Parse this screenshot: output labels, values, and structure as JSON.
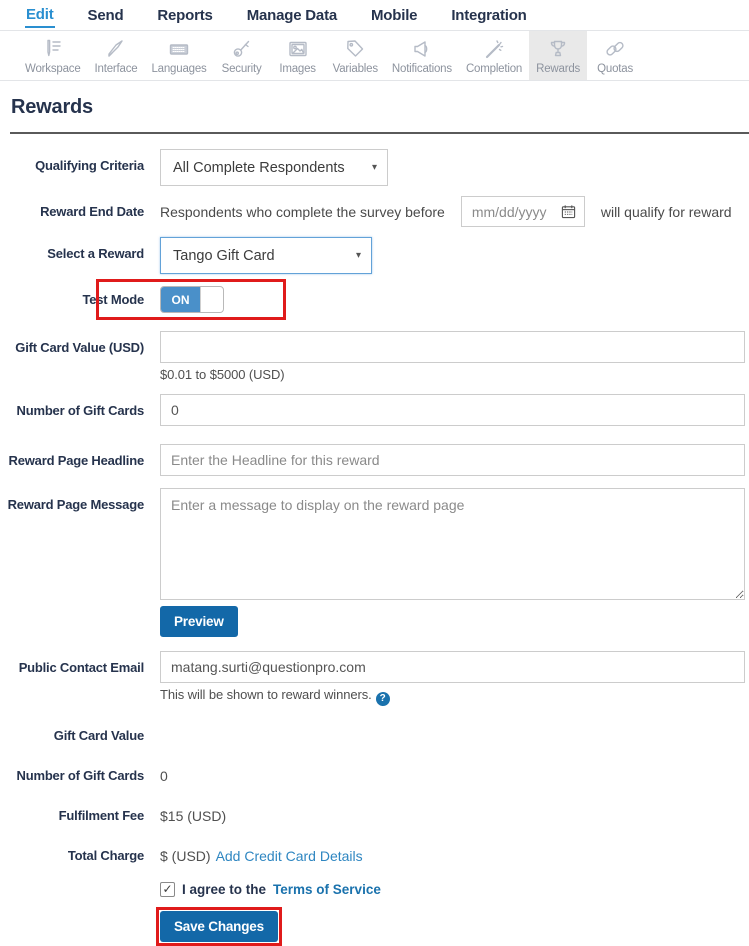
{
  "nav": {
    "items": [
      {
        "label": "Edit",
        "active": true
      },
      {
        "label": "Send",
        "active": false
      },
      {
        "label": "Reports",
        "active": false
      },
      {
        "label": "Manage Data",
        "active": false
      },
      {
        "label": "Mobile",
        "active": false
      },
      {
        "label": "Integration",
        "active": false
      }
    ]
  },
  "toolbar": {
    "items": [
      {
        "label": "Workspace",
        "icon": "workspace-icon",
        "active": false
      },
      {
        "label": "Interface",
        "icon": "interface-icon",
        "active": false
      },
      {
        "label": "Languages",
        "icon": "languages-icon",
        "active": false
      },
      {
        "label": "Security",
        "icon": "security-icon",
        "active": false
      },
      {
        "label": "Images",
        "icon": "images-icon",
        "active": false
      },
      {
        "label": "Variables",
        "icon": "variables-icon",
        "active": false
      },
      {
        "label": "Notifications",
        "icon": "notifications-icon",
        "active": false
      },
      {
        "label": "Completion",
        "icon": "completion-icon",
        "active": false
      },
      {
        "label": "Rewards",
        "icon": "rewards-icon",
        "active": true
      },
      {
        "label": "Quotas",
        "icon": "quotas-icon",
        "active": false
      }
    ]
  },
  "page": {
    "title": "Rewards"
  },
  "form": {
    "qualifying_criteria": {
      "label": "Qualifying Criteria",
      "value": "All Complete Respondents"
    },
    "reward_end_date": {
      "label": "Reward End Date",
      "prefix": "Respondents who complete the survey before",
      "placeholder": "mm/dd/yyyy",
      "suffix": "will qualify for reward"
    },
    "select_reward": {
      "label": "Select a Reward",
      "value": "Tango Gift Card"
    },
    "test_mode": {
      "label": "Test Mode",
      "state": "ON"
    },
    "gift_card_value": {
      "label": "Gift Card Value (USD)",
      "value": "",
      "hint": "$0.01 to $5000 (USD)"
    },
    "number_of_gift_cards": {
      "label": "Number of Gift Cards",
      "value": "0"
    },
    "reward_page_headline": {
      "label": "Reward Page Headline",
      "placeholder": "Enter the Headline for this reward"
    },
    "reward_page_message": {
      "label": "Reward Page Message",
      "placeholder": "Enter a message to display on the reward page"
    },
    "preview_button": "Preview",
    "public_contact_email": {
      "label": "Public Contact Email",
      "value": "matang.surti@questionpro.com",
      "hint": "This will be shown to reward winners.",
      "help_glyph": "?"
    },
    "summary": {
      "gift_card_value": {
        "label": "Gift Card Value",
        "value": ""
      },
      "number_of_gift_cards": {
        "label": "Number of Gift Cards",
        "value": "0"
      },
      "fulfilment_fee": {
        "label": "Fulfilment Fee",
        "value": "$15 (USD)"
      },
      "total_charge": {
        "label": "Total Charge",
        "value": "$ (USD)",
        "link": "Add Credit Card Details"
      }
    },
    "agree": {
      "checked": true,
      "check_glyph": "✓",
      "text": "I agree to the",
      "link": "Terms of Service"
    },
    "save_button": "Save Changes"
  },
  "colors": {
    "accent_blue": "#1368a8",
    "toggle_blue": "#4a90c9",
    "nav_active_blue": "#2a8fd0",
    "navy_text": "#26334d",
    "annotation_red": "#e01b1b"
  }
}
